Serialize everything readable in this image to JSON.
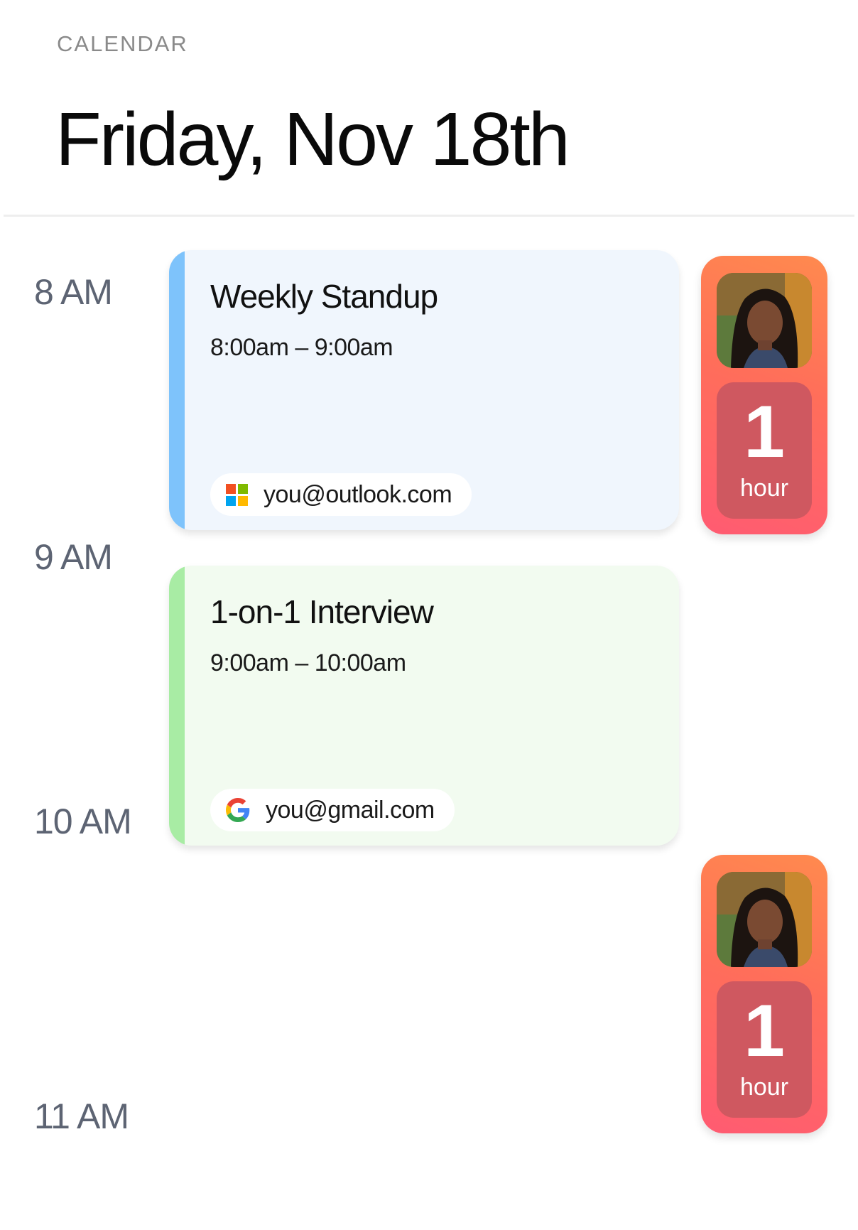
{
  "header": {
    "eyebrow": "CALENDAR",
    "title": "Friday, Nov 18th"
  },
  "timeline": {
    "hours": [
      "8 AM",
      "9 AM",
      "10 AM",
      "11 AM"
    ]
  },
  "events": [
    {
      "title": "Weekly Standup",
      "time": "8:00am – 9:00am",
      "account": "you@outlook.com",
      "account_icon": "microsoft-icon",
      "background": "#f0f6fd",
      "accent": "#7ec3fb"
    },
    {
      "title": "1-on-1 Interview",
      "time": "9:00am – 10:00am",
      "account": "you@gmail.com",
      "account_icon": "google-icon",
      "background": "#f2fbf0",
      "accent": "#a8eca4"
    }
  ],
  "duration_chips": [
    {
      "value": "1",
      "unit": "hour"
    },
    {
      "value": "1",
      "unit": "hour"
    }
  ],
  "colors": {
    "chip_gradient_top": "#ff8a4e",
    "chip_gradient_bottom": "#ff5b72",
    "chip_inner": "#cf5860"
  }
}
